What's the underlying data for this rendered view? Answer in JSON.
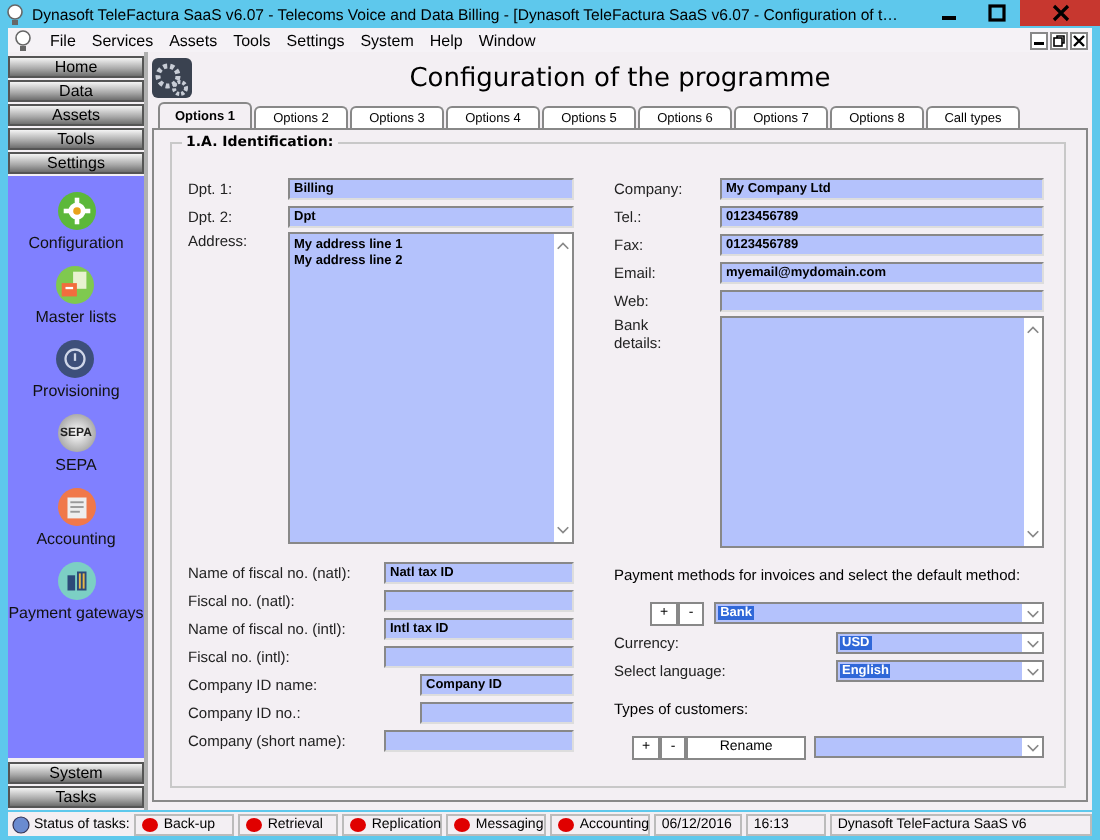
{
  "window": {
    "title": "Dynasoft TeleFactura SaaS v6.07 - Telecoms Voice and Data Billing - [Dynasoft TeleFactura SaaS v6.07 - Configuration of t…"
  },
  "menu": [
    "File",
    "Services",
    "Assets",
    "Tools",
    "Settings",
    "System",
    "Help",
    "Window"
  ],
  "sidebar": {
    "top_buttons": [
      "Home",
      "Data",
      "Assets",
      "Tools",
      "Settings"
    ],
    "modules": [
      {
        "label": "Configuration"
      },
      {
        "label": "Master lists"
      },
      {
        "label": "Provisioning"
      },
      {
        "label": "SEPA",
        "icon_label": "SEPA"
      },
      {
        "label": "Accounting"
      },
      {
        "label": "Payment gateways"
      }
    ],
    "bottom_buttons": [
      "System",
      "Tasks"
    ]
  },
  "heading": "Configuration of the programme",
  "tabs": [
    {
      "label": "Options 1",
      "selected": true
    },
    {
      "label": "Options 2",
      "selected": false
    },
    {
      "label": "Options 3",
      "selected": false
    },
    {
      "label": "Options 4",
      "selected": false
    },
    {
      "label": "Options 5",
      "selected": false
    },
    {
      "label": "Options 6",
      "selected": false
    },
    {
      "label": "Options 7",
      "selected": false
    },
    {
      "label": "Options 8",
      "selected": false
    },
    {
      "label": "Call types",
      "selected": false
    }
  ],
  "section_title": "1.A. Identification:",
  "left_fields": [
    {
      "label": "Dpt. 1:",
      "value": "Billing"
    },
    {
      "label": "Dpt. 2:",
      "value": "Dpt"
    }
  ],
  "address": {
    "label": "Address:",
    "lines": [
      "My address line 1",
      "My address line 2"
    ]
  },
  "fiscal_fields": [
    {
      "label": "Name of fiscal no. (natl):",
      "value": "Natl tax ID"
    },
    {
      "label": "Fiscal no. (natl):"
    },
    {
      "label": "Name of fiscal no. (intl):",
      "value": "Intl tax ID"
    },
    {
      "label": "Fiscal no. (intl):"
    },
    {
      "label": "Company ID name:",
      "value": "Company ID"
    },
    {
      "label": "Company ID no.:"
    },
    {
      "label": "Company (short name):"
    }
  ],
  "right_fields": [
    {
      "label": "Company:",
      "value": "My Company Ltd"
    },
    {
      "label": "Tel.:",
      "value": "0123456789"
    },
    {
      "label": "Fax:",
      "value": "0123456789"
    },
    {
      "label": "Email:",
      "value": "myemail@mydomain.com"
    },
    {
      "label": "Web:"
    }
  ],
  "bank_details": {
    "label": "Bank details:"
  },
  "payment_methods": {
    "label": "Payment methods for invoices and select the default method:",
    "buttons": [
      "+",
      "-"
    ],
    "value": "Bank",
    "highlighted": true
  },
  "currency": {
    "label": "Currency:",
    "value": "USD",
    "highlighted": true
  },
  "language": {
    "label": "Select language:",
    "value": "English",
    "highlighted": true
  },
  "customer_types": {
    "label": "Types of customers:",
    "buttons": [
      "+",
      "-",
      "Rename"
    ]
  },
  "status_bar": {
    "label": "Status of tasks:",
    "tasks": [
      {
        "label": "Back-up",
        "color": "#e00000"
      },
      {
        "label": "Retrieval",
        "color": "#e00000"
      },
      {
        "label": "Replication",
        "color": "#e00000"
      },
      {
        "label": "Messaging",
        "color": "#e00000"
      },
      {
        "label": "Accounting",
        "color": "#e00000"
      }
    ],
    "date": "06/12/2016",
    "time": "16:13",
    "app": "Dynasoft TeleFactura SaaS v6"
  }
}
